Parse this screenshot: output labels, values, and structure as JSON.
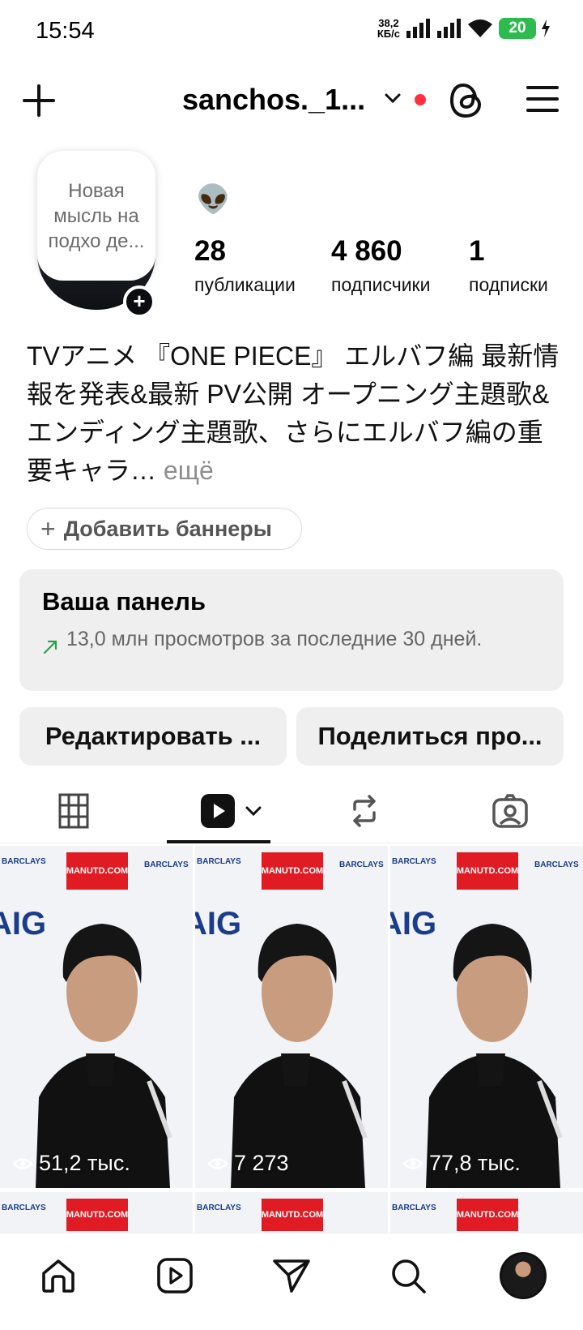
{
  "status_bar": {
    "time": "15:54",
    "speed_value": "38,2",
    "speed_unit": "КБ/с",
    "battery": "20"
  },
  "header": {
    "username": "sanchos._1...",
    "icons": [
      "plus-icon",
      "chevron-down-icon",
      "threads-icon",
      "menu-icon"
    ],
    "notification_dot_color": "#ff3040"
  },
  "profile": {
    "note": "Новая мысль на подхо де...",
    "emoji": "👽",
    "stats": [
      {
        "value": "28",
        "label": "публикации"
      },
      {
        "value": "4 860",
        "label": "подписчики"
      },
      {
        "value": "1",
        "label": "подписки"
      }
    ],
    "bio": "TVアニメ 『ONE PIECE』 エルバフ編 最新情報を発表&最新 PV公開 オープニング主題歌&エンディング主題歌、さらにエルバフ編の重要キャラ…",
    "bio_more": "ещё",
    "add_banners": "Добавить баннеры"
  },
  "dashboard": {
    "title": "Ваша панель",
    "subtitle": "13,0 млн просмотров за последние 30 дней.",
    "arrow_color": "#2aa24a"
  },
  "actions": {
    "edit": "Редактировать ...",
    "share": "Поделиться про..."
  },
  "tabs": [
    "grid-icon",
    "reels-icon",
    "reposts-icon",
    "tagged-icon"
  ],
  "grid": {
    "tiles": [
      {
        "views": "51,2 тыс."
      },
      {
        "views": "7 273"
      },
      {
        "views": "77,8 тыс."
      }
    ],
    "board_text": {
      "manutd": "MANUTD.COM",
      "barclays": "BARCLAYS",
      "aig": "AIG"
    }
  },
  "bottom_nav": [
    "home-icon",
    "reels-icon",
    "direct-icon",
    "search-icon",
    "profile-avatar"
  ]
}
